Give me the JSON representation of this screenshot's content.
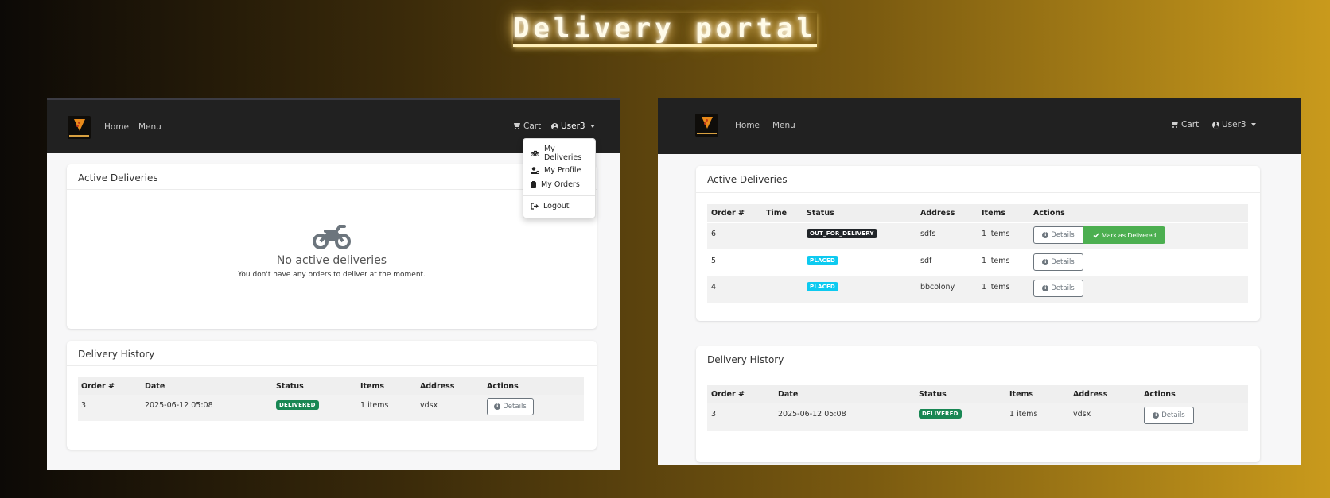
{
  "page_title": "Delivery portal",
  "colors": {
    "navbar": "#212121",
    "badge_delivered": "#198754",
    "badge_placed": "#0dcaf0",
    "badge_out_for_delivery": "#212529",
    "mark_delivered_button": "#4caf50"
  },
  "left": {
    "nav": {
      "home": "Home",
      "menu": "Menu",
      "cart": "Cart",
      "user": "User3"
    },
    "dropdown": {
      "items": [
        {
          "label": "My Deliveries",
          "icon": "motorcycle-icon"
        },
        {
          "label": "My Profile",
          "icon": "user-gear-icon"
        },
        {
          "label": "My Orders",
          "icon": "clipboard-icon"
        },
        {
          "label": "Logout",
          "icon": "logout-icon"
        }
      ]
    },
    "active": {
      "title": "Active Deliveries",
      "empty_title": "No active deliveries",
      "empty_text": "You don't have any orders to deliver at the moment."
    },
    "history": {
      "title": "Delivery History",
      "columns": [
        "Order #",
        "Date",
        "Status",
        "Items",
        "Address",
        "Actions"
      ],
      "rows": [
        {
          "order": "3",
          "date": "2025-06-12 05:08",
          "status": "DELIVERED",
          "items": "1 items",
          "address": "vdsx",
          "action": "Details"
        }
      ]
    }
  },
  "right": {
    "nav": {
      "home": "Home",
      "menu": "Menu",
      "cart": "Cart",
      "user": "User3"
    },
    "active": {
      "title": "Active Deliveries",
      "columns": [
        "Order #",
        "Time",
        "Status",
        "Address",
        "Items",
        "Actions"
      ],
      "rows": [
        {
          "order": "6",
          "time": "",
          "status": "OUT_FOR_DELIVERY",
          "address": "sdfs",
          "items": "1 items",
          "action": "Details",
          "action2": "Mark as Delivered"
        },
        {
          "order": "5",
          "time": "",
          "status": "PLACED",
          "address": "sdf",
          "items": "1 items",
          "action": "Details"
        },
        {
          "order": "4",
          "time": "",
          "status": "PLACED",
          "address": "bbcolony",
          "items": "1 items",
          "action": "Details"
        }
      ]
    },
    "history": {
      "title": "Delivery History",
      "columns": [
        "Order #",
        "Date",
        "Status",
        "Items",
        "Address",
        "Actions"
      ],
      "rows": [
        {
          "order": "3",
          "date": "2025-06-12 05:08",
          "status": "DELIVERED",
          "items": "1 items",
          "address": "vdsx",
          "action": "Details"
        }
      ]
    }
  }
}
